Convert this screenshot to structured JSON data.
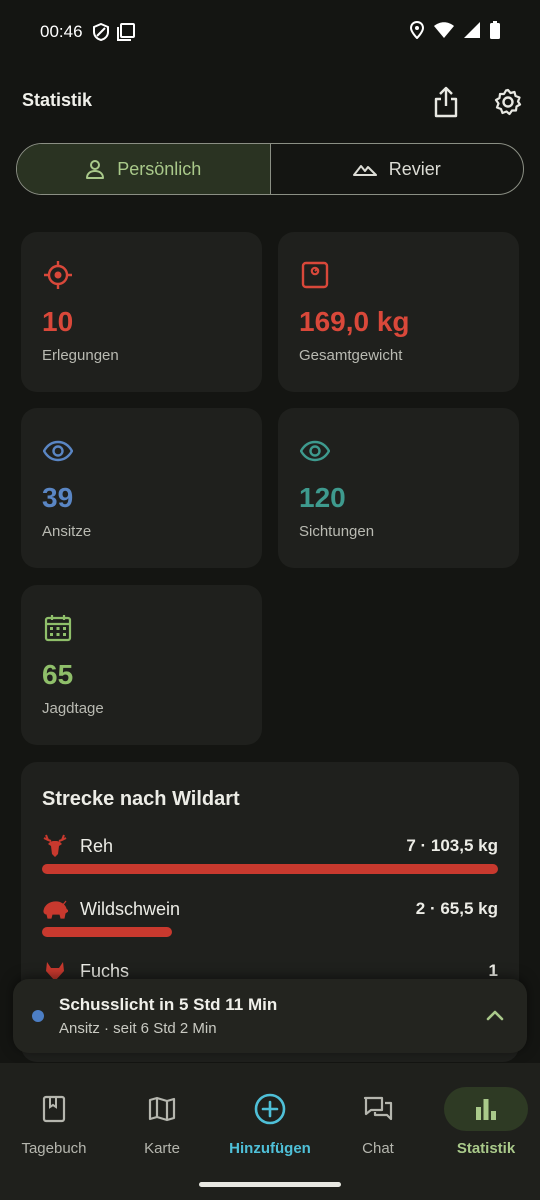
{
  "status_bar": {
    "time": "00:46"
  },
  "header": {
    "title": "Statistik"
  },
  "segments": [
    {
      "label": "Persönlich",
      "icon": "person-icon",
      "active": true
    },
    {
      "label": "Revier",
      "icon": "mountain-icon",
      "active": false
    }
  ],
  "cards": [
    {
      "value": "10",
      "label": "Erlegungen",
      "icon": "target-icon",
      "color": "#d9483a"
    },
    {
      "value": "169,0 kg",
      "label": "Gesamtgewicht",
      "icon": "scale-icon",
      "color": "#d9483a"
    },
    {
      "value": "39",
      "label": "Ansitze",
      "icon": "eye-icon",
      "color": "#5a86c4"
    },
    {
      "value": "120",
      "label": "Sichtungen",
      "icon": "eye-icon",
      "color": "#3e9a8e"
    },
    {
      "value": "65",
      "label": "Jagdtage",
      "icon": "calendar-icon",
      "color": "#8fbf6a"
    }
  ],
  "strecke": {
    "title": "Strecke nach Wildart",
    "items": [
      {
        "name": "Reh",
        "value": "7 · 103,5 kg",
        "icon": "deer-icon",
        "share": 1.0
      },
      {
        "name": "Wildschwein",
        "value": "2 · 65,5 kg",
        "icon": "boar-icon",
        "share": 0.285
      },
      {
        "name": "Fuchs",
        "value": "1",
        "icon": "fox-icon"
      }
    ]
  },
  "notification": {
    "title": "Schusslicht in 5 Std 11 Min",
    "subtitle": "Ansitz · seit 6 Std 2 Min"
  },
  "nav": [
    {
      "label": "Tagebuch",
      "icon": "bookmark-book-icon"
    },
    {
      "label": "Karte",
      "icon": "map-icon"
    },
    {
      "label": "Hinzufügen",
      "icon": "plus-circle-icon"
    },
    {
      "label": "Chat",
      "icon": "chat-icon"
    },
    {
      "label": "Statistik",
      "icon": "bar-chart-icon",
      "active": true
    }
  ],
  "colors": {
    "accent_green": "#a9c98a",
    "red": "#c8392e",
    "cyan": "#4fc0d8"
  }
}
